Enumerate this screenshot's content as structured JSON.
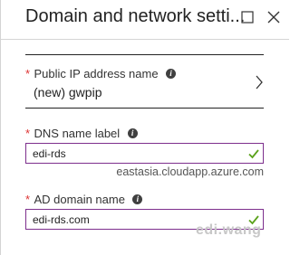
{
  "blade": {
    "title": "Domain and network setti..."
  },
  "public_ip": {
    "required_marker": "*",
    "label": "Public IP address name",
    "value": "(new) gwpip"
  },
  "dns": {
    "required_marker": "*",
    "label": "DNS name label",
    "value": "edi-rds",
    "suffix": "eastasia.cloudapp.azure.com"
  },
  "ad_domain": {
    "required_marker": "*",
    "label": "AD domain name",
    "value": "edi-rds.com"
  },
  "watermark": "edi.wang",
  "icons": {
    "info": "info-icon",
    "maximize": "maximize-icon",
    "close": "close-icon",
    "chevron": "chevron-right-icon",
    "check": "checkmark-icon"
  },
  "colors": {
    "required": "#dd3333",
    "input_border": "#7d2f8d",
    "valid_check": "#5ba21b"
  }
}
